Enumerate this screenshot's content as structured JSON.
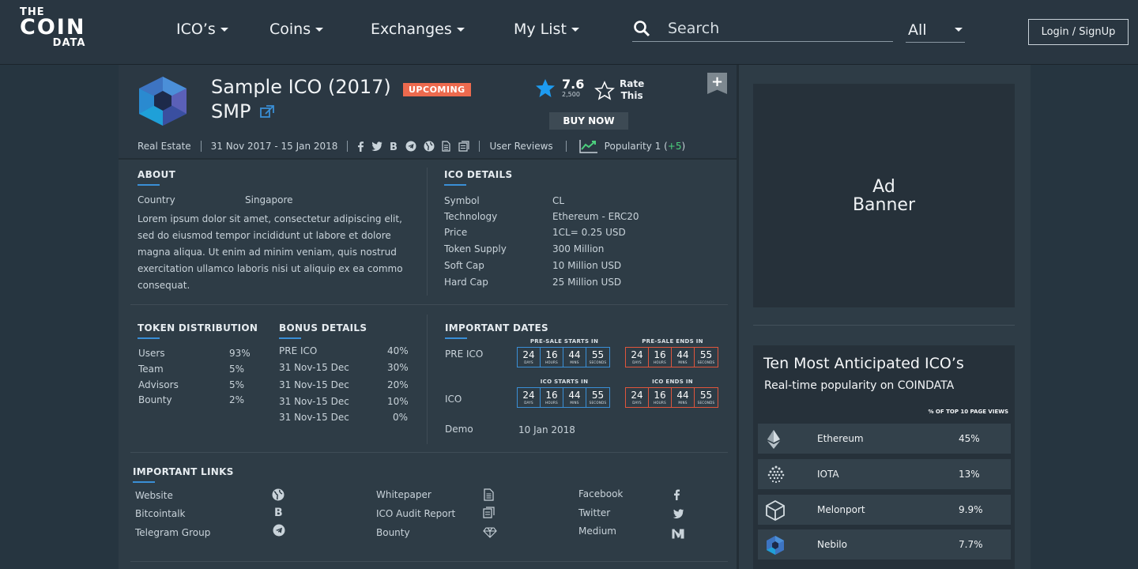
{
  "header": {
    "logo_top": "THE",
    "logo_mid": "COIN",
    "logo_bot": "DATA",
    "nav": [
      {
        "label": "ICO’s"
      },
      {
        "label": "Coins"
      },
      {
        "label": "Exchanges"
      },
      {
        "label": "My List"
      }
    ],
    "search_placeholder": "Search",
    "filter_value": "All",
    "login_label": "Login / SignUp"
  },
  "ico": {
    "title": "Sample ICO (2017)",
    "symbol": "SMP",
    "status_badge": "UPCOMING",
    "rating": "7.6",
    "rating_count": "2,500",
    "rate_this_1": "Rate",
    "rate_this_2": "This",
    "buy_now": "BUY NOW",
    "bookmark": "+",
    "category": "Real Estate",
    "date_range": "31 Nov 2017 - 15 Jan 2018",
    "user_reviews": "User Reviews",
    "popularity": "Popularity 1 (",
    "popularity_change": "+5",
    "popularity_close": ")"
  },
  "about": {
    "title": "ABOUT",
    "country_label": "Country",
    "country_value": "Singapore",
    "description": "Lorem ipsum dolor sit amet, consectetur adipiscing elit, sed do eiusmod tempor incididunt ut labore et dolore magna aliqua. Ut enim ad minim veniam, quis nostrud exercitation ullamco laboris nisi ut aliquip ex ea commo consequat."
  },
  "ico_details": {
    "title": "ICO DETAILS",
    "rows": [
      {
        "k": "Symbol",
        "v": "CL"
      },
      {
        "k": "Technology",
        "v": "Ethereum - ERC20"
      },
      {
        "k": "Price",
        "v": "1CL= 0.25 USD"
      },
      {
        "k": "Token Supply",
        "v": "300 Million"
      },
      {
        "k": "Soft Cap",
        "v": "10 Million USD"
      },
      {
        "k": "Hard Cap",
        "v": "25 Million USD"
      }
    ]
  },
  "token_distribution": {
    "title": "TOKEN DISTRIBUTION",
    "rows": [
      {
        "k": "Users",
        "v": "93%"
      },
      {
        "k": "Team",
        "v": "5%"
      },
      {
        "k": "Advisors",
        "v": "5%"
      },
      {
        "k": "Bounty",
        "v": "2%"
      }
    ]
  },
  "bonus_details": {
    "title": "BONUS DETAILS",
    "rows": [
      {
        "k": "PRE ICO",
        "v": "40%"
      },
      {
        "k": "31 Nov-15 Dec",
        "v": "30%"
      },
      {
        "k": "31 Nov-15 Dec",
        "v": "20%"
      },
      {
        "k": "31 Nov-15 Dec",
        "v": "10%"
      },
      {
        "k": "31 Nov-15 Dec",
        "v": "0%"
      }
    ]
  },
  "important_dates": {
    "title": "IMPORTANT DATES",
    "pre_ico_label": "PRE ICO",
    "ico_label": "ICO",
    "demo_label": "Demo",
    "demo_value": "10 Jan 2018",
    "units": [
      "DAYS",
      "HOURS",
      "MINS",
      "SECONDS"
    ],
    "timers": [
      {
        "label": "PRE-SALE STARTS IN",
        "values": [
          "24",
          "16",
          "44",
          "55"
        ]
      },
      {
        "label": "PRE-SALE ENDS IN",
        "values": [
          "24",
          "16",
          "44",
          "55"
        ]
      },
      {
        "label": "ICO STARTS IN",
        "values": [
          "24",
          "16",
          "44",
          "55"
        ]
      },
      {
        "label": "ICO ENDS IN",
        "values": [
          "24",
          "16",
          "44",
          "55"
        ]
      }
    ]
  },
  "important_links": {
    "title": "IMPORTANT LINKS",
    "col1": [
      "Website",
      "Bitcointalk",
      "Telegram Group"
    ],
    "col2": [
      "Whitepaper",
      "ICO Audit Report",
      "Bounty"
    ],
    "col3": [
      "Facebook",
      "Twitter",
      "Medium"
    ]
  },
  "sidebar": {
    "ad_line1": "Ad",
    "ad_line2": "Banner",
    "top10_title": "Ten Most Anticipated ICO’s",
    "top10_subtitle": "Real-time popularity on COINDATA",
    "top10_header": "% OF TOP 10 PAGE VIEWS",
    "coins": [
      {
        "name": "Ethereum",
        "pct": "45%",
        "icon": "ethereum-icon"
      },
      {
        "name": "IOTA",
        "pct": "13%",
        "icon": "iota-icon"
      },
      {
        "name": "Melonport",
        "pct": "9.9%",
        "icon": "melonport-icon"
      },
      {
        "name": "Nebilo",
        "pct": "7.7%",
        "icon": "nebilo-icon"
      }
    ]
  },
  "colors": {
    "accent_blue": "#3a8fd6",
    "badge_orange": "#ed6a4e",
    "timer_red": "#e0553c",
    "positive_green": "#4cd07d"
  }
}
